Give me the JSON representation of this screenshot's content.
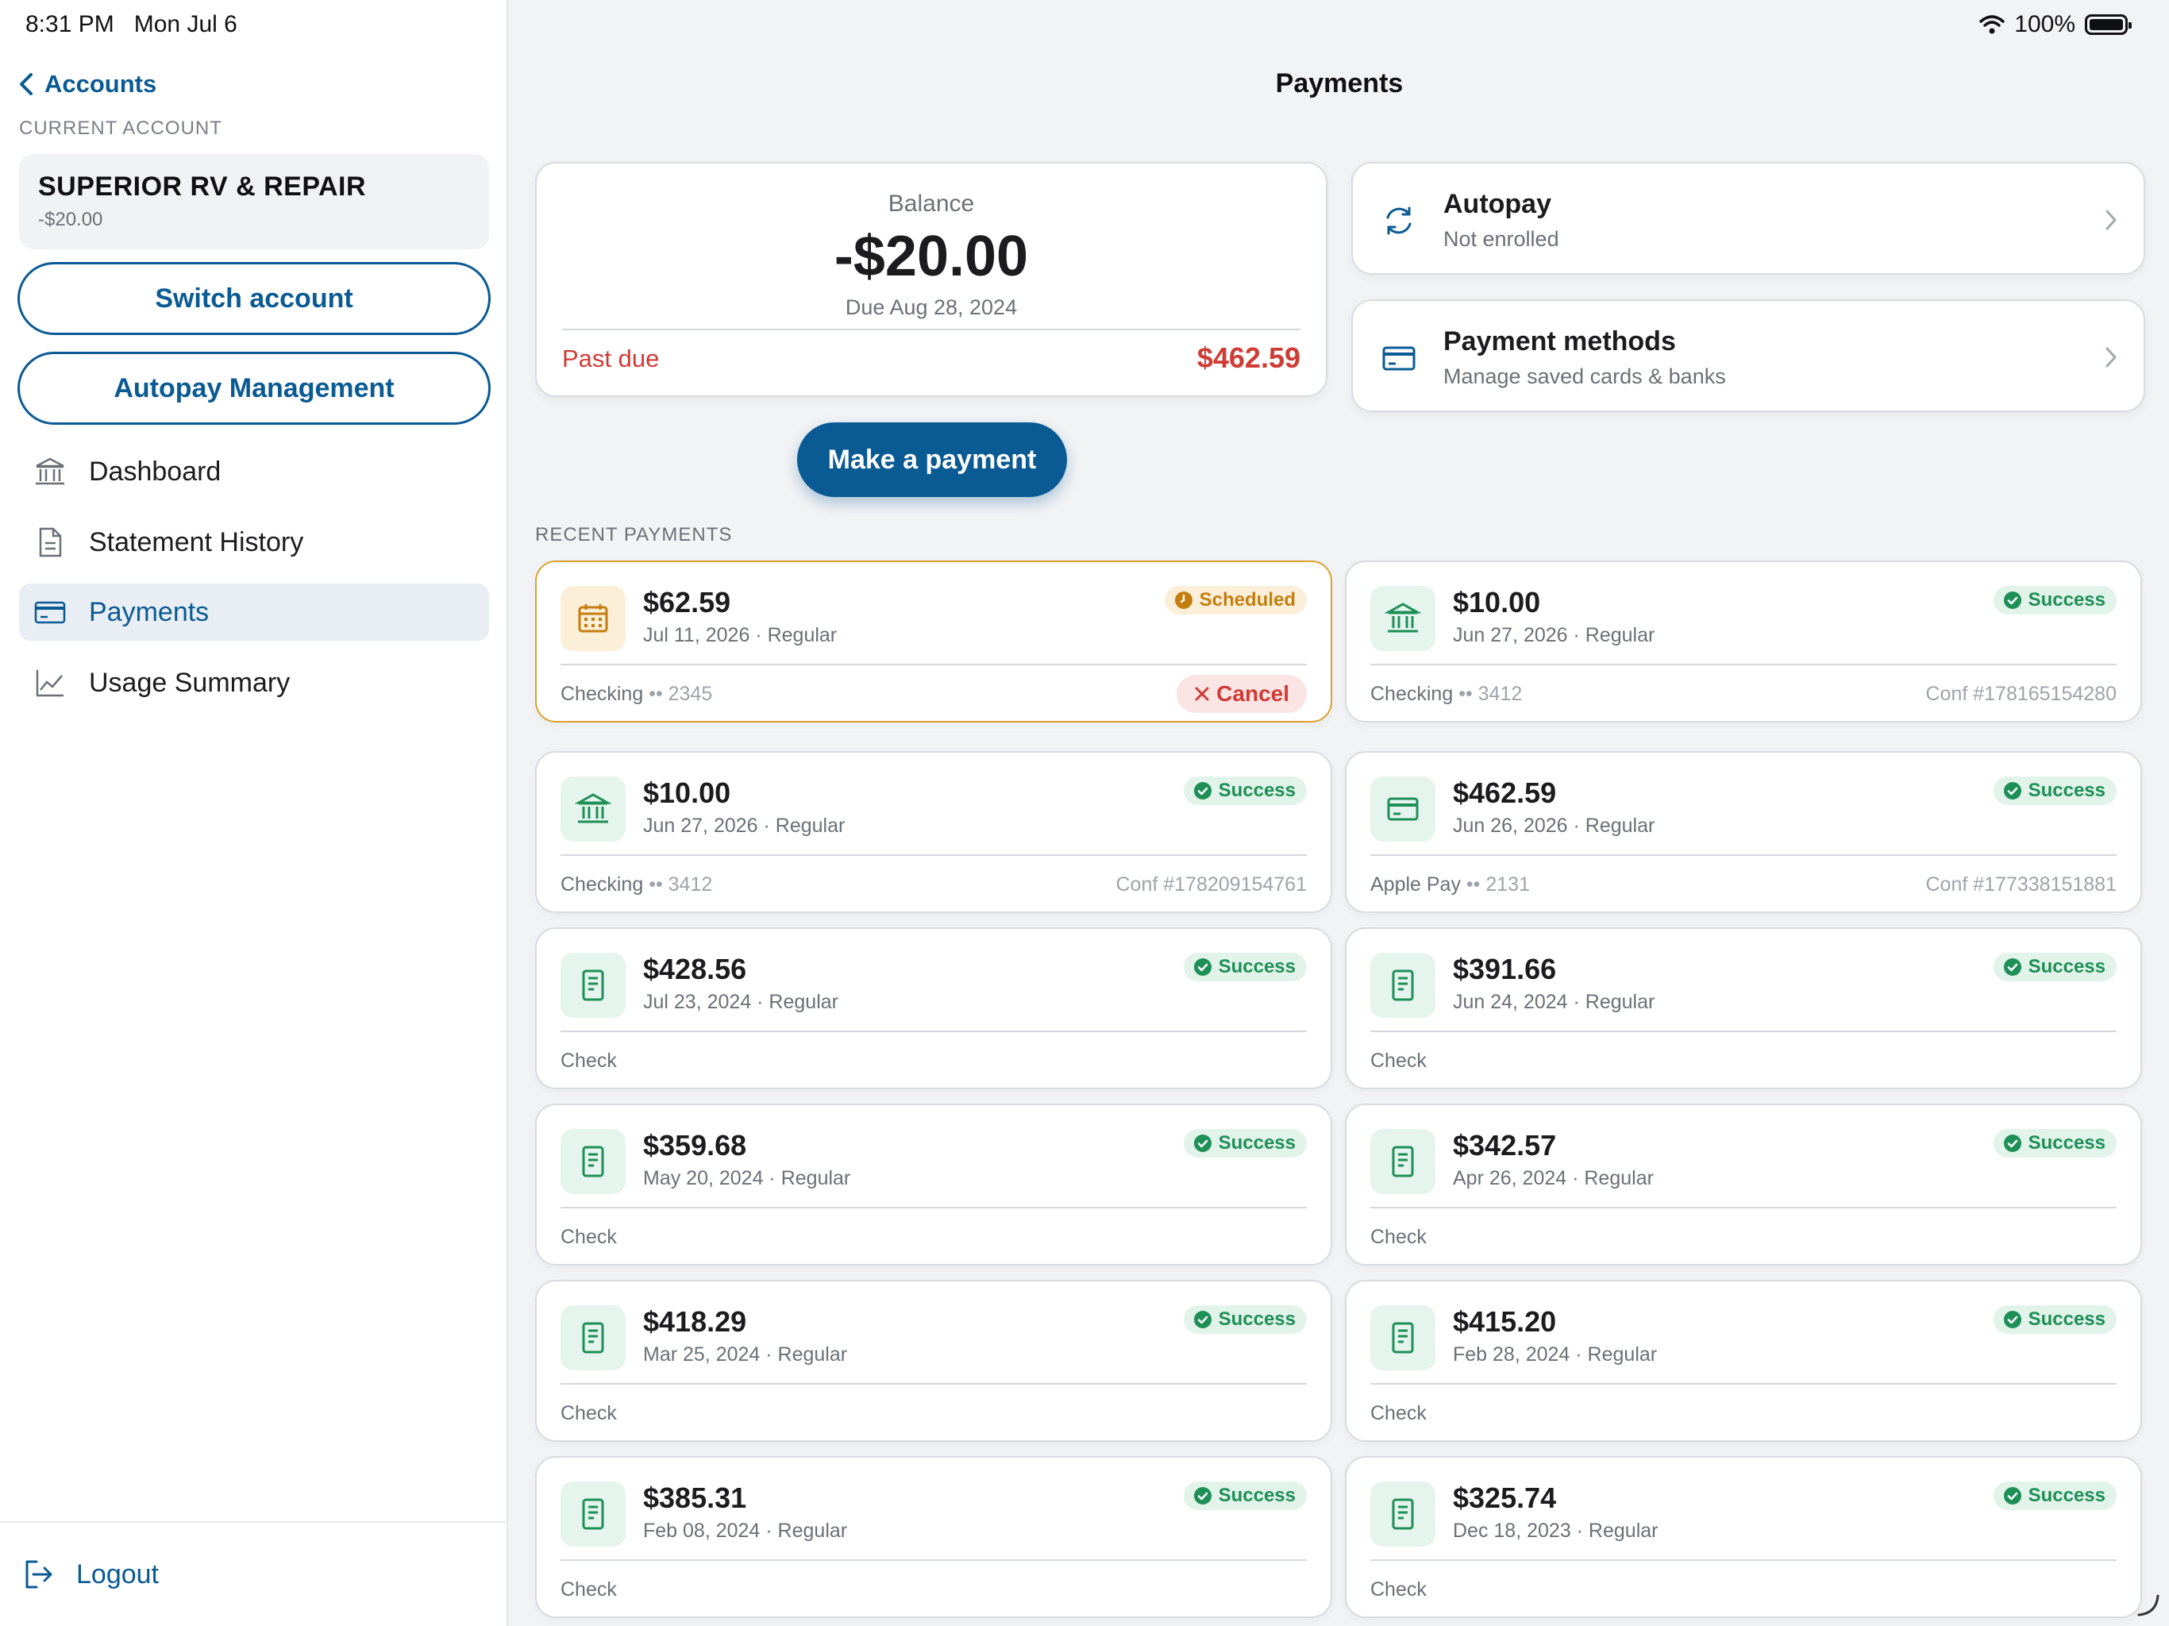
{
  "status_bar": {
    "time": "8:31 PM",
    "date": "Mon Jul 6",
    "battery": "100%"
  },
  "sidebar": {
    "back_label": "Accounts",
    "current_account_label": "CURRENT ACCOUNT",
    "account": {
      "name": "SUPERIOR RV & REPAIR",
      "balance": "-$20.00"
    },
    "switch_account_label": "Switch account",
    "autopay_management_label": "Autopay Management",
    "nav": [
      {
        "label": "Dashboard",
        "icon": "bank-icon",
        "active": false
      },
      {
        "label": "Statement History",
        "icon": "document-icon",
        "active": false
      },
      {
        "label": "Payments",
        "icon": "card-icon",
        "active": true
      },
      {
        "label": "Usage Summary",
        "icon": "chart-icon",
        "active": false
      }
    ],
    "logout_label": "Logout"
  },
  "header": {
    "title": "Payments"
  },
  "balance_card": {
    "label": "Balance",
    "amount": "-$20.00",
    "due": "Due Aug 28, 2024",
    "past_due_label": "Past due",
    "past_due_amount": "$462.59"
  },
  "autopay_card": {
    "title": "Autopay",
    "subtitle": "Not enrolled",
    "icon": "refresh-icon"
  },
  "payment_methods_card": {
    "title": "Payment methods",
    "subtitle": "Manage saved cards & banks",
    "icon": "card-icon"
  },
  "make_payment_label": "Make a payment",
  "recent_label": "RECENT PAYMENTS",
  "colors": {
    "accent": "#0a5a94",
    "success": "#1d8f57",
    "scheduled": "#c47e10",
    "danger": "#cf3b35"
  },
  "payments": [
    {
      "amount": "$62.59",
      "date": "Jul 11, 2026 · Regular",
      "status": "Scheduled",
      "method": "Checking",
      "digits": "•• 2345",
      "conf": "",
      "icon": "calendar-icon",
      "action": "Cancel"
    },
    {
      "amount": "$10.00",
      "date": "Jun 27, 2026 · Regular",
      "status": "Success",
      "method": "Checking",
      "digits": "•• 3412",
      "conf": "Conf #178165154280",
      "icon": "bank-icon",
      "action": ""
    },
    {
      "amount": "$10.00",
      "date": "Jun 27, 2026 · Regular",
      "status": "Success",
      "method": "Checking",
      "digits": "•• 3412",
      "conf": "Conf #178209154761",
      "icon": "bank-icon",
      "action": ""
    },
    {
      "amount": "$462.59",
      "date": "Jun 26, 2026 · Regular",
      "status": "Success",
      "method": "Apple Pay",
      "digits": "•• 2131",
      "conf": "Conf #177338151881",
      "icon": "card-icon",
      "action": ""
    },
    {
      "amount": "$428.56",
      "date": "Jul 23, 2024 · Regular",
      "status": "Success",
      "method": "Check",
      "digits": "",
      "conf": "",
      "icon": "check-document-icon",
      "action": ""
    },
    {
      "amount": "$391.66",
      "date": "Jun 24, 2024 · Regular",
      "status": "Success",
      "method": "Check",
      "digits": "",
      "conf": "",
      "icon": "check-document-icon",
      "action": ""
    },
    {
      "amount": "$359.68",
      "date": "May 20, 2024 · Regular",
      "status": "Success",
      "method": "Check",
      "digits": "",
      "conf": "",
      "icon": "check-document-icon",
      "action": ""
    },
    {
      "amount": "$342.57",
      "date": "Apr 26, 2024 · Regular",
      "status": "Success",
      "method": "Check",
      "digits": "",
      "conf": "",
      "icon": "check-document-icon",
      "action": ""
    },
    {
      "amount": "$418.29",
      "date": "Mar 25, 2024 · Regular",
      "status": "Success",
      "method": "Check",
      "digits": "",
      "conf": "",
      "icon": "check-document-icon",
      "action": ""
    },
    {
      "amount": "$415.20",
      "date": "Feb 28, 2024 · Regular",
      "status": "Success",
      "method": "Check",
      "digits": "",
      "conf": "",
      "icon": "check-document-icon",
      "action": ""
    },
    {
      "amount": "$385.31",
      "date": "Feb 08, 2024 · Regular",
      "status": "Success",
      "method": "Check",
      "digits": "",
      "conf": "",
      "icon": "check-document-icon",
      "action": ""
    },
    {
      "amount": "$325.74",
      "date": "Dec 18, 2023 · Regular",
      "status": "Success",
      "method": "Check",
      "digits": "",
      "conf": "",
      "icon": "check-document-icon",
      "action": ""
    }
  ]
}
